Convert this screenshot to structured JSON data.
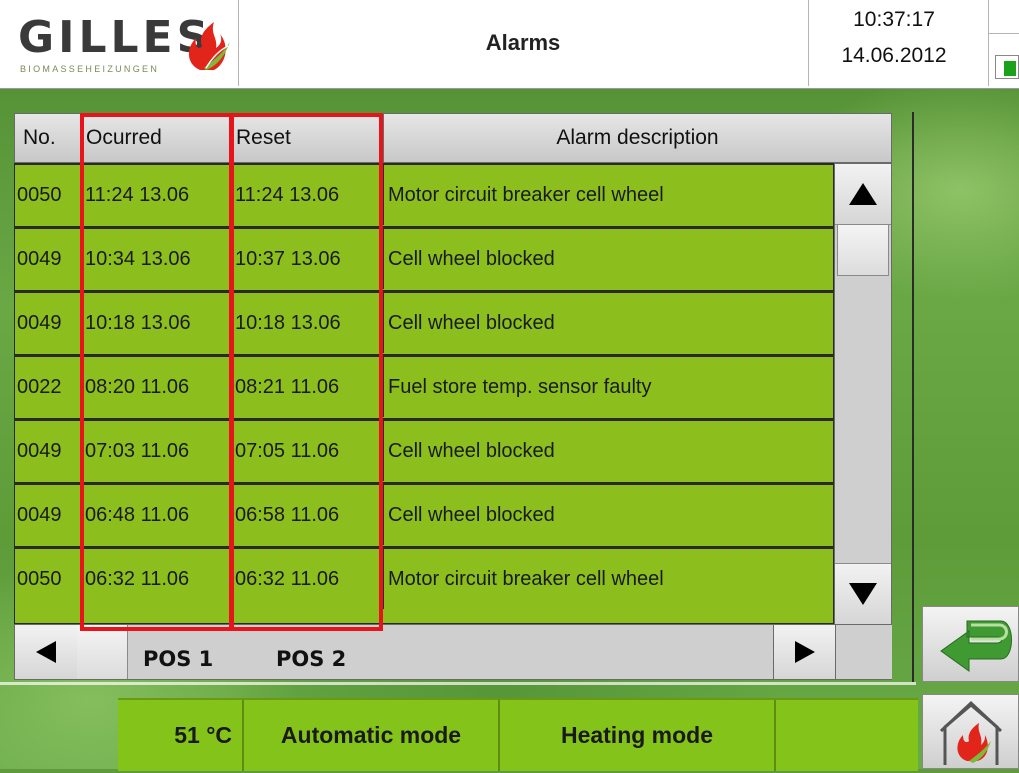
{
  "header": {
    "logo_text": "GILLES",
    "logo_sub": "BIOMASSEHEIZUNGEN",
    "title": "Alarms",
    "time": "10:37:17",
    "date": "14.06.2012"
  },
  "table": {
    "headers": {
      "no": "No.",
      "occurred": "Ocurred",
      "reset": "Reset",
      "description": "Alarm description"
    },
    "rows": [
      {
        "no": "0050",
        "occurred": "11:24 13.06",
        "reset": "11:24 13.06",
        "description": "Motor circuit breaker cell wheel"
      },
      {
        "no": "0049",
        "occurred": "10:34 13.06",
        "reset": "10:37 13.06",
        "description": "Cell wheel blocked"
      },
      {
        "no": "0049",
        "occurred": "10:18 13.06",
        "reset": "10:18 13.06",
        "description": "Cell wheel blocked"
      },
      {
        "no": "0022",
        "occurred": "08:20 11.06",
        "reset": "08:21 11.06",
        "description": "Fuel store temp. sensor faulty"
      },
      {
        "no": "0049",
        "occurred": "07:03 11.06",
        "reset": "07:05 11.06",
        "description": "Cell wheel blocked"
      },
      {
        "no": "0049",
        "occurred": "06:48 11.06",
        "reset": "06:58 11.06",
        "description": "Cell wheel blocked"
      },
      {
        "no": "0050",
        "occurred": "06:32 11.06",
        "reset": "06:32 11.06",
        "description": "Motor circuit breaker cell wheel"
      }
    ]
  },
  "annotations": {
    "pos1": "POS 1",
    "pos2": "POS 2",
    "highlight_color": "#e8141b"
  },
  "statusbar": {
    "temperature": "51 °C",
    "mode": "Automatic mode",
    "heating": "Heating mode",
    "extra": ""
  },
  "icons": {
    "scroll_up": "triangle-up-icon",
    "scroll_down": "triangle-down-icon",
    "scroll_left": "triangle-left-icon",
    "scroll_right": "triangle-right-icon",
    "back": "return-arrow-icon",
    "home": "house-flame-icon",
    "logo": "flame-leaf-icon"
  },
  "colors": {
    "row_green": "#8cbf1e",
    "status_green": "#84c41a",
    "accent_red": "#e8141b"
  }
}
